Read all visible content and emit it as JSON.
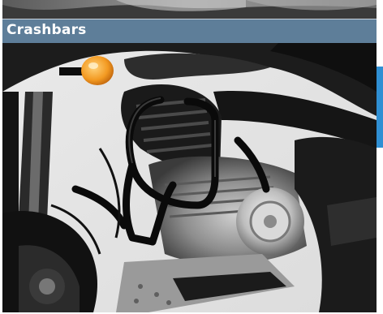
{
  "caption": {
    "title": "Crashbars"
  },
  "images": {
    "top_photo_alt": "",
    "main_photo_alt": ""
  },
  "colors": {
    "caption_bg": "#5e7e99",
    "caption_text": "#ffffff",
    "side_tab": "#2f8fd3"
  }
}
